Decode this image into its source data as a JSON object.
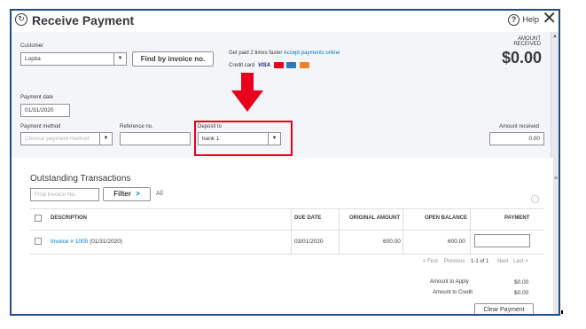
{
  "window": {
    "title": "Receive Payment",
    "help_label": "Help"
  },
  "customer": {
    "label": "Customer",
    "value": "Lopita",
    "find_button": "Find by invoice no."
  },
  "promo": {
    "text": "Get paid 2 times faster",
    "link": "Accept payments online",
    "credit_card_label": "Credit card",
    "visa": "VISA"
  },
  "amount_received_header": {
    "label_line1": "AMOUNT",
    "label_line2": "RECEIVED",
    "value": "$0.00"
  },
  "payment_date": {
    "label": "Payment date",
    "value": "01/31/2020"
  },
  "payment_method": {
    "label": "Payment method",
    "placeholder": "Choose payment method"
  },
  "reference": {
    "label": "Reference no.",
    "value": ""
  },
  "deposit_to": {
    "label": "Deposit to",
    "value": "bank 1"
  },
  "amount_received": {
    "label": "Amount received",
    "value": "0.00"
  },
  "outstanding": {
    "title": "Outstanding Transactions",
    "search_placeholder": "Find Invoice No.",
    "filter_label": "Filter",
    "filter_chevron": ">",
    "all_label": "All",
    "columns": [
      "DESCRIPTION",
      "DUE DATE",
      "ORIGINAL AMOUNT",
      "OPEN BALANCE",
      "PAYMENT"
    ],
    "rows": [
      {
        "link": "Invoice # 1005",
        "date_suffix": "(01/31/2020)",
        "due_date": "03/01/2020",
        "original_amount": "600.00",
        "open_balance": "600.00",
        "payment": ""
      }
    ],
    "pager": {
      "first": "< First",
      "previous": "Previous",
      "range": "1-1 of 1",
      "next": "Next",
      "last": "Last >"
    }
  },
  "totals": {
    "apply_label": "Amount to Apply",
    "apply_value": "$0.00",
    "credit_label": "Amount to Credit",
    "credit_value": "$0.00",
    "clear_button": "Clear Payment"
  },
  "colors": {
    "frame_border": "#1f4d8a",
    "highlight": "#e8001c",
    "arrow": "#e8001c",
    "link": "#0077c5"
  }
}
